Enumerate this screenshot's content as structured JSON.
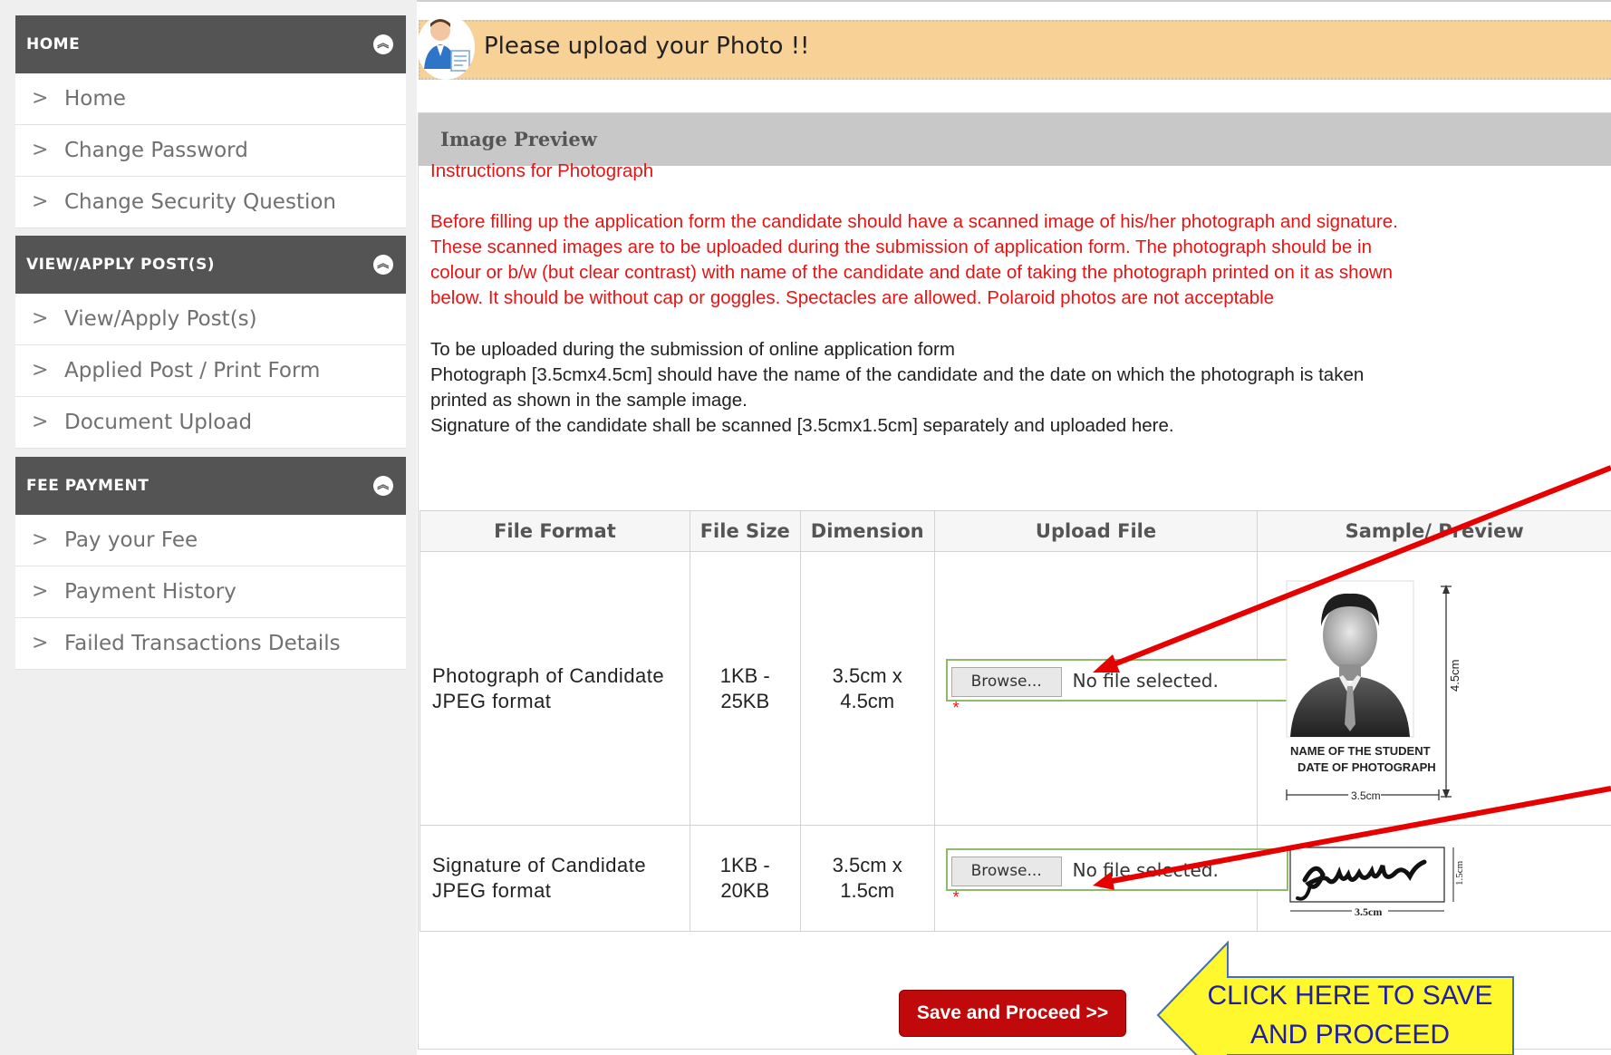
{
  "sidebar": {
    "sections": [
      {
        "title": "HOME",
        "items": [
          "Home",
          "Change Password",
          "Change Security Question"
        ]
      },
      {
        "title": "VIEW/APPLY POST(S)",
        "items": [
          "View/Apply Post(s)",
          "Applied Post / Print Form",
          "Document Upload"
        ]
      },
      {
        "title": "FEE PAYMENT",
        "items": [
          "Pay your Fee",
          "Payment History",
          "Failed Transactions Details"
        ]
      }
    ]
  },
  "banner": {
    "text": "Please upload your Photo !!"
  },
  "panel": {
    "title": "Image Preview",
    "instructions_title": "Instructions for Photograph",
    "instructions_red": [
      "Before filling up the application form the candidate should have a scanned image of his/her photograph and signature.",
      "These scanned images are to be uploaded during the submission of application form. The photograph should be in",
      "colour or b/w (but clear contrast) with name of the candidate and date of taking the photograph printed on it as shown",
      "below. It should be without cap or goggles. Spectacles are allowed. Polaroid photos are not acceptable"
    ],
    "instructions_black": [
      "To be uploaded during the submission of online application form",
      "Photograph [3.5cmx4.5cm] should have the name of the candidate and the date on which the photograph is taken",
      "printed as shown in the sample image.",
      "Signature of the candidate shall be scanned [3.5cmx1.5cm] separately and uploaded here."
    ]
  },
  "table": {
    "headers": [
      "File Format",
      "File Size",
      "Dimension",
      "Upload File",
      "Sample/ Preview"
    ],
    "rows": [
      {
        "format": [
          "Photograph of Candidate",
          "JPEG format"
        ],
        "size": [
          "1KB -",
          "25KB"
        ],
        "dimension": [
          "3.5cm x",
          "4.5cm"
        ],
        "browse": "Browse...",
        "status": "No file selected.",
        "required": "*"
      },
      {
        "format": [
          "Signature of Candidate",
          "JPEG format"
        ],
        "size": [
          "1KB -",
          "20KB"
        ],
        "dimension": [
          "3.5cm x",
          "1.5cm"
        ],
        "browse": "Browse...",
        "status": "No file selected.",
        "required": "*"
      }
    ]
  },
  "sample": {
    "photo_name": "NAME OF THE STUDENT",
    "photo_date": "DATE OF PHOTOGRAPH",
    "photo_width": "3.5cm",
    "photo_height": "4.5cm",
    "sig_width": "3.5cm",
    "sig_height": "1.5cm"
  },
  "save_button": "Save and Proceed >>",
  "callout": {
    "line1": "CLICK HERE TO SAVE",
    "line2": "AND PROCEED"
  },
  "colors": {
    "header_bar": "#545454",
    "banner": "#f8d196",
    "instruction_red": "#e61414",
    "save_button": "#c0090b",
    "arrow": "#e60000",
    "callout_fill": "#fff82e"
  }
}
